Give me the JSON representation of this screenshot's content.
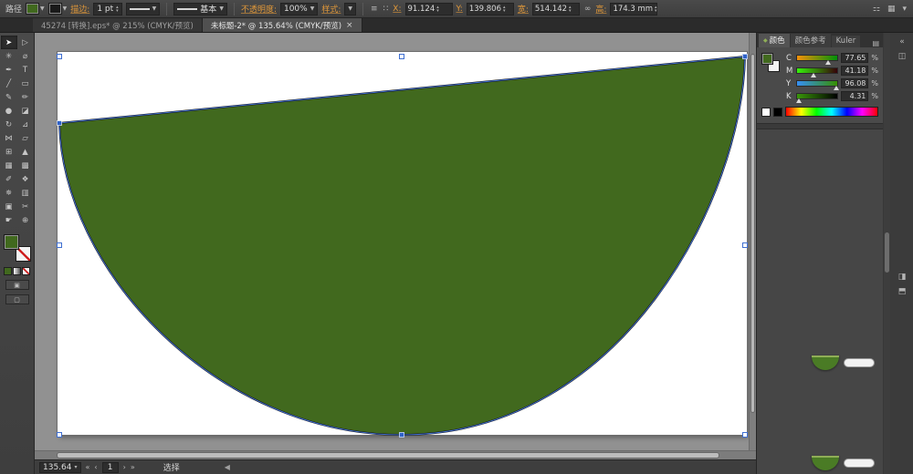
{
  "colors": {
    "accent_link": "#e0983a",
    "selection_blue": "#3f6fd1",
    "shape_green": "#41691e"
  },
  "control_bar": {
    "target_label": "路径",
    "stroke_link": "描边:",
    "stroke_weight": "1 pt",
    "brush_value": "基本",
    "opacity_link": "不透明度:",
    "opacity_value": "100%",
    "style_link": "样式:",
    "x_label": "X:",
    "x_value": "91.124",
    "y_label": "Y:",
    "y_value": "139.806",
    "w_label": "宽:",
    "w_value": "514.142",
    "h_label": "高:",
    "h_value": "174.3 mm"
  },
  "document_tabs": [
    {
      "title": "45274 [转换].eps* @ 215% (CMYK/预览)"
    },
    {
      "title": "未标题-2* @ 135.64% (CMYK/预览)",
      "close": "×"
    }
  ],
  "tools": [
    {
      "name": "selection-tool",
      "glyph": "➤",
      "active": true
    },
    {
      "name": "direct-selection-tool",
      "glyph": "▷"
    },
    {
      "name": "magic-wand-tool",
      "glyph": "✳"
    },
    {
      "name": "lasso-tool",
      "glyph": "⌀"
    },
    {
      "name": "pen-tool",
      "glyph": "✒"
    },
    {
      "name": "type-tool",
      "glyph": "T"
    },
    {
      "name": "line-segment-tool",
      "glyph": "╱"
    },
    {
      "name": "rectangle-tool",
      "glyph": "▭"
    },
    {
      "name": "paintbrush-tool",
      "glyph": "✎"
    },
    {
      "name": "pencil-tool",
      "glyph": "✏"
    },
    {
      "name": "blob-brush-tool",
      "glyph": "●"
    },
    {
      "name": "eraser-tool",
      "glyph": "◪"
    },
    {
      "name": "rotate-tool",
      "glyph": "↻"
    },
    {
      "name": "scale-tool",
      "glyph": "⊿"
    },
    {
      "name": "width-tool",
      "glyph": "⋈"
    },
    {
      "name": "free-transform-tool",
      "glyph": "▱"
    },
    {
      "name": "shape-builder-tool",
      "glyph": "⊞"
    },
    {
      "name": "perspective-grid-tool",
      "glyph": "▲"
    },
    {
      "name": "mesh-tool",
      "glyph": "▦"
    },
    {
      "name": "gradient-tool",
      "glyph": "▩"
    },
    {
      "name": "eyedropper-tool",
      "glyph": "✐"
    },
    {
      "name": "blend-tool",
      "glyph": "❖"
    },
    {
      "name": "symbol-sprayer-tool",
      "glyph": "✵"
    },
    {
      "name": "column-graph-tool",
      "glyph": "▥"
    },
    {
      "name": "artboard-tool",
      "glyph": "▣"
    },
    {
      "name": "slice-tool",
      "glyph": "✂"
    },
    {
      "name": "hand-tool",
      "glyph": "☛"
    },
    {
      "name": "zoom-tool",
      "glyph": "⊕"
    }
  ],
  "color_panel": {
    "tabs": [
      {
        "label": "颜色"
      },
      {
        "label": "颜色参考"
      },
      {
        "label": "Kuler"
      }
    ],
    "sliders": [
      {
        "label": "C",
        "value": "77.65",
        "suffix": "%"
      },
      {
        "label": "M",
        "value": "41.18",
        "suffix": "%"
      },
      {
        "label": "Y",
        "value": "96.08",
        "suffix": "%"
      },
      {
        "label": "K",
        "value": "4.31",
        "suffix": "%"
      }
    ]
  },
  "status_bar": {
    "zoom_value": "135.64",
    "artboard_number": "1",
    "tool_status": "选择"
  },
  "canvas": {
    "shape": {
      "fill": "#41691e",
      "stroke": "#16120d"
    }
  }
}
